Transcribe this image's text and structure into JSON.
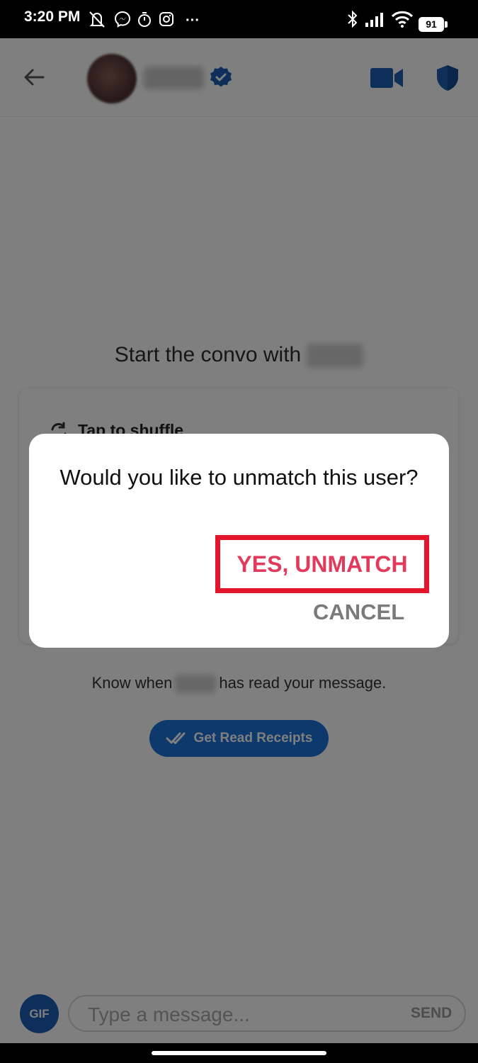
{
  "status_bar": {
    "time": "3:20 PM",
    "more": "···",
    "battery": "91",
    "icons": [
      "mute-off-icon",
      "messenger-icon",
      "timer-icon",
      "instagram-icon",
      "bluetooth-icon",
      "signal-icon",
      "wifi-icon",
      "battery-icon"
    ]
  },
  "header": {
    "icons": [
      "back-arrow-icon",
      "verified-badge-icon",
      "video-call-icon",
      "shield-icon"
    ],
    "accent": "#1a5fb4"
  },
  "conversation": {
    "start_text": "Start the convo with",
    "shuffle_label": "Tap to shuffle",
    "know_prefix": "Know when",
    "know_suffix": "has read your message.",
    "receipts_button": "Get Read Receipts"
  },
  "dialog": {
    "title": "Would you like to unmatch this user?",
    "confirm": "YES, UNMATCH",
    "cancel": "CANCEL",
    "confirm_color": "#e23a5a",
    "highlight_color": "#e4142c"
  },
  "composer": {
    "gif": "GIF",
    "placeholder": "Type a message...",
    "send": "SEND"
  }
}
